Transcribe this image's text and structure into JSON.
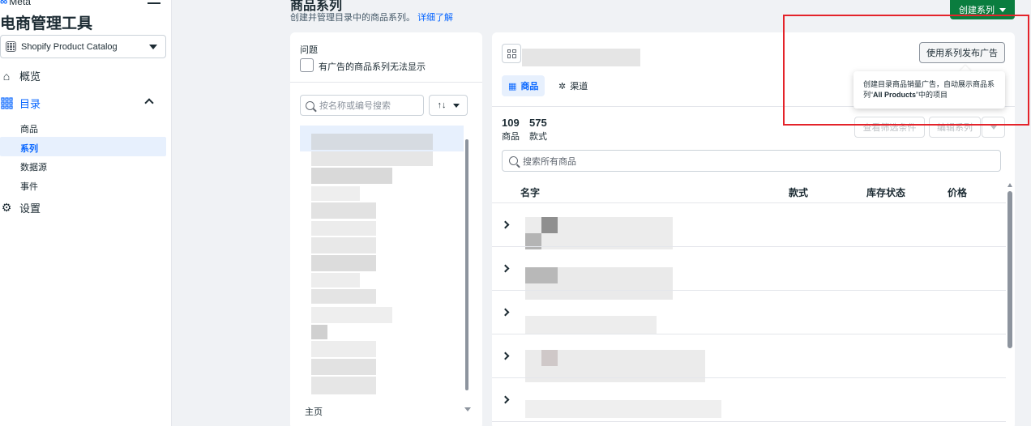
{
  "sidebar": {
    "brand": "Meta",
    "app_title": "电商管理工具",
    "catalog": "Shopify Product Catalog",
    "nav": {
      "overview": "概览",
      "catalog": "目录",
      "settings": "设置"
    },
    "sub_items": [
      "商品",
      "系列",
      "数据源",
      "事件"
    ],
    "active_sub": "系列"
  },
  "header": {
    "title": "商品系列",
    "subtitle": "创建并管理目录中的商品系列。",
    "learn_more": "详细了解",
    "create_button": "创建系列"
  },
  "left_panel": {
    "issues_label": "问题",
    "issue_filter": "有广告的商品系列无法显示",
    "search_placeholder": "按名称或编号搜索",
    "sort_label": "↑↓",
    "footer_item": "主页"
  },
  "right_panel": {
    "tabs": [
      "商品",
      "渠道"
    ],
    "publish_button": "使用系列发布广告",
    "tooltip": {
      "text_before": "创建目录商品销量广告，自动展示商品系列“",
      "highlight": "All Products",
      "text_after": "”中的项目"
    },
    "stats": [
      {
        "value": "109",
        "label": "商品"
      },
      {
        "value": "575",
        "label": "款式"
      }
    ],
    "view_filters_button": "查看筛选条件",
    "edit_button": "编辑系列",
    "search_placeholder": "搜索所有商品",
    "columns": [
      "名字",
      "款式",
      "库存状态",
      "价格"
    ]
  },
  "colors": {
    "accent": "#0866ff",
    "create_button": "#0a7d3f",
    "highlight_box": "#e4232a"
  }
}
